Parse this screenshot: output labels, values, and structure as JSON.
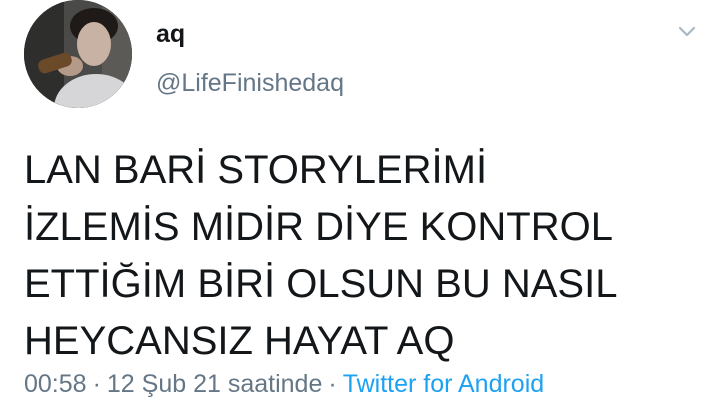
{
  "user": {
    "display_name": "aq",
    "handle": "@LifeFinishedaq",
    "avatar_icon": "profile-photo"
  },
  "tweet": {
    "lines": [
      "LAN BARİ STORYLERİMİ",
      "İZLEMİS MİDİR DİYE KONTROL",
      "ETTİĞİM BİRİ OLSUN BU NASIL",
      "HEYCANSIZ HAYAT AQ"
    ]
  },
  "meta": {
    "time": "00:58",
    "separator": "·",
    "date": "12 Şub 21 saatinde",
    "source": "Twitter for Android"
  },
  "menu_icon": "chevron-down-icon",
  "colors": {
    "text": "#14171a",
    "muted": "#657786",
    "link": "#1da1f2"
  }
}
